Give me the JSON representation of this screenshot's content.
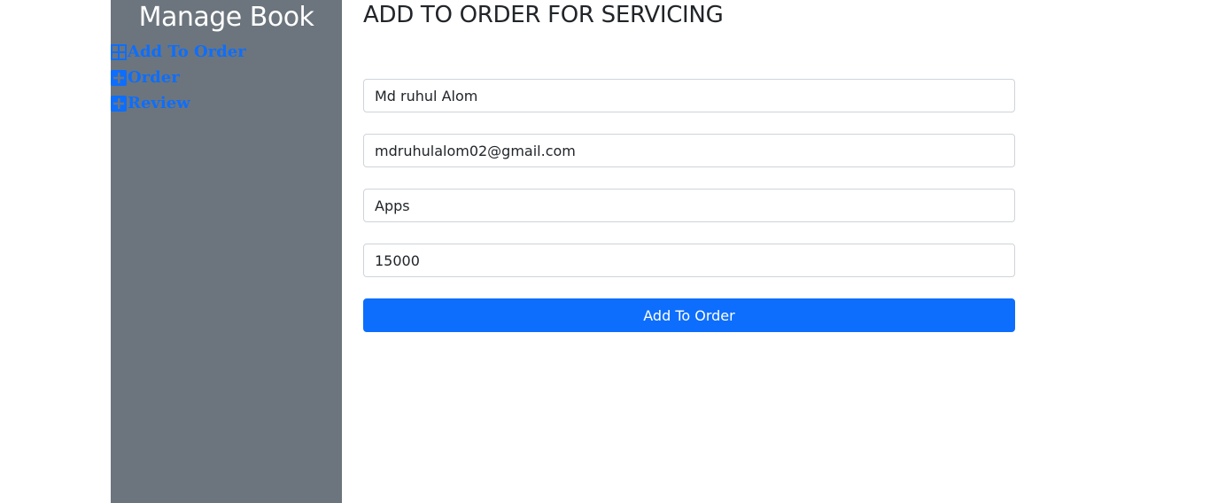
{
  "sidebar": {
    "title": "Manage Book",
    "items": [
      {
        "label": "Add To Order",
        "icon": "grid-plus-icon"
      },
      {
        "label": "Order",
        "icon": "plus-square-icon"
      },
      {
        "label": "Review",
        "icon": "plus-square-icon"
      }
    ]
  },
  "main": {
    "title": "ADD TO ORDER FOR SERVICING",
    "fields": {
      "name": {
        "value": "Md ruhul Alom"
      },
      "email": {
        "value": "mdruhulalom02@gmail.com"
      },
      "service": {
        "value": "Apps"
      },
      "price": {
        "value": "15000"
      }
    },
    "submit_label": "Add To Order"
  },
  "colors": {
    "sidebar_bg": "#6c757d",
    "accent": "#0d6efd",
    "text": "#212529",
    "input_border": "#ced4da"
  }
}
